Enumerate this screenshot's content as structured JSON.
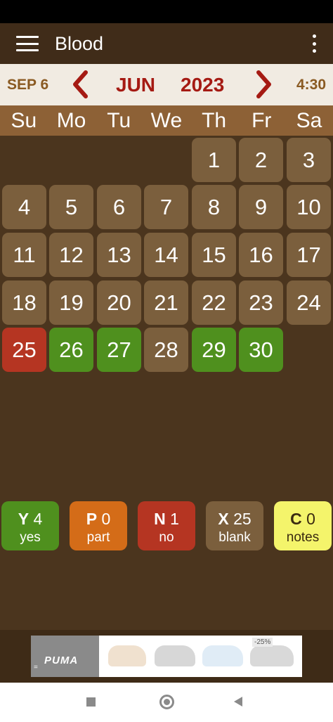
{
  "app": {
    "title": "Blood"
  },
  "nav": {
    "today_date": "SEP 6",
    "month": "JUN",
    "year": "2023",
    "clock": "4:30"
  },
  "weekdays": [
    "Su",
    "Mo",
    "Tu",
    "We",
    "Th",
    "Fr",
    "Sa"
  ],
  "calendar": {
    "first_weekday_index": 4,
    "days": [
      {
        "d": "1",
        "s": "blank"
      },
      {
        "d": "2",
        "s": "blank"
      },
      {
        "d": "3",
        "s": "blank"
      },
      {
        "d": "4",
        "s": "blank"
      },
      {
        "d": "5",
        "s": "blank"
      },
      {
        "d": "6",
        "s": "blank"
      },
      {
        "d": "7",
        "s": "blank"
      },
      {
        "d": "8",
        "s": "blank"
      },
      {
        "d": "9",
        "s": "blank"
      },
      {
        "d": "10",
        "s": "blank"
      },
      {
        "d": "11",
        "s": "blank"
      },
      {
        "d": "12",
        "s": "blank"
      },
      {
        "d": "13",
        "s": "blank"
      },
      {
        "d": "14",
        "s": "blank"
      },
      {
        "d": "15",
        "s": "blank"
      },
      {
        "d": "16",
        "s": "blank"
      },
      {
        "d": "17",
        "s": "blank"
      },
      {
        "d": "18",
        "s": "blank"
      },
      {
        "d": "19",
        "s": "blank"
      },
      {
        "d": "20",
        "s": "blank"
      },
      {
        "d": "21",
        "s": "blank"
      },
      {
        "d": "22",
        "s": "blank"
      },
      {
        "d": "23",
        "s": "blank"
      },
      {
        "d": "24",
        "s": "blank"
      },
      {
        "d": "25",
        "s": "no"
      },
      {
        "d": "26",
        "s": "yes"
      },
      {
        "d": "27",
        "s": "yes"
      },
      {
        "d": "28",
        "s": "blank"
      },
      {
        "d": "29",
        "s": "yes"
      },
      {
        "d": "30",
        "s": "yes"
      }
    ]
  },
  "summary": {
    "yes": {
      "letter": "Y",
      "count": "4",
      "label": "yes"
    },
    "part": {
      "letter": "P",
      "count": "0",
      "label": "part"
    },
    "no": {
      "letter": "N",
      "count": "1",
      "label": "no"
    },
    "blank": {
      "letter": "X",
      "count": "25",
      "label": "blank"
    },
    "notes": {
      "letter": "C",
      "count": "0",
      "label": "notes"
    }
  },
  "ad": {
    "brand": "PUMA",
    "discount": "-25%"
  },
  "colors": {
    "background": "#4b351e",
    "app_bar": "#402c19",
    "header": "#8d6136",
    "cell": "#7b5f3d",
    "yes": "#4f901e",
    "part": "#d46c18",
    "no": "#b53522",
    "notes": "#f4f46b",
    "accent_red": "#a51a13"
  },
  "icons": {
    "menu": "hamburger-menu-icon",
    "more": "more-vertical-icon",
    "prev": "chevron-left-icon",
    "next": "chevron-right-icon"
  }
}
